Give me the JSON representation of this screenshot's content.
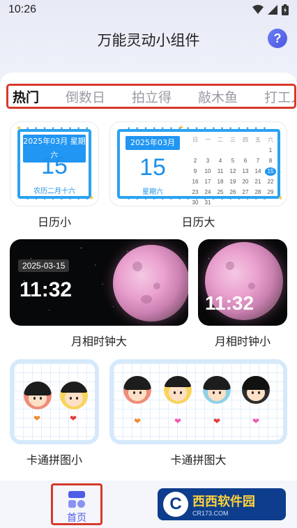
{
  "status_bar": {
    "time": "10:26"
  },
  "header": {
    "title": "万能灵动小组件",
    "help_glyph": "?"
  },
  "tabs": [
    {
      "label": "热门",
      "active": true
    },
    {
      "label": "倒数日",
      "active": false
    },
    {
      "label": "拍立得",
      "active": false
    },
    {
      "label": "敲木鱼",
      "active": false
    },
    {
      "label": "打工人",
      "active": false
    }
  ],
  "widgets": {
    "calendar_small": {
      "label": "日历小",
      "header": "2025年03月 星期六",
      "day": "15",
      "lunar": "农历二月十六"
    },
    "calendar_large": {
      "label": "日历大",
      "header": "2025年03月",
      "day": "15",
      "weekday": "星期六",
      "week_headers": [
        "日",
        "一",
        "二",
        "三",
        "四",
        "五",
        "六"
      ],
      "days": [
        "",
        "",
        "",
        "",
        "",
        "",
        "1",
        "2",
        "3",
        "4",
        "5",
        "6",
        "7",
        "8",
        "9",
        "10",
        "11",
        "12",
        "13",
        "14",
        "15",
        "16",
        "17",
        "18",
        "19",
        "20",
        "21",
        "22",
        "23",
        "24",
        "25",
        "26",
        "27",
        "28",
        "29",
        "30",
        "31",
        "",
        "",
        "",
        "",
        ""
      ],
      "today": "15"
    },
    "moon_large": {
      "label": "月相时钟大",
      "date": "2025-03-15",
      "time": "11:32"
    },
    "moon_small": {
      "label": "月相时钟小",
      "time": "11:32"
    },
    "cartoon_small": {
      "label": "卡通拼图小"
    },
    "cartoon_large": {
      "label": "卡通拼图大"
    }
  },
  "bottom_nav": {
    "home_label": "首页"
  },
  "watermark": {
    "brand": "西西软件园",
    "url": "CR173.COM",
    "logo_glyph": "C"
  },
  "colors": {
    "accent": "#4f5ce8",
    "calendar_blue": "#2196f3",
    "highlight_border": "#d63a2a"
  }
}
